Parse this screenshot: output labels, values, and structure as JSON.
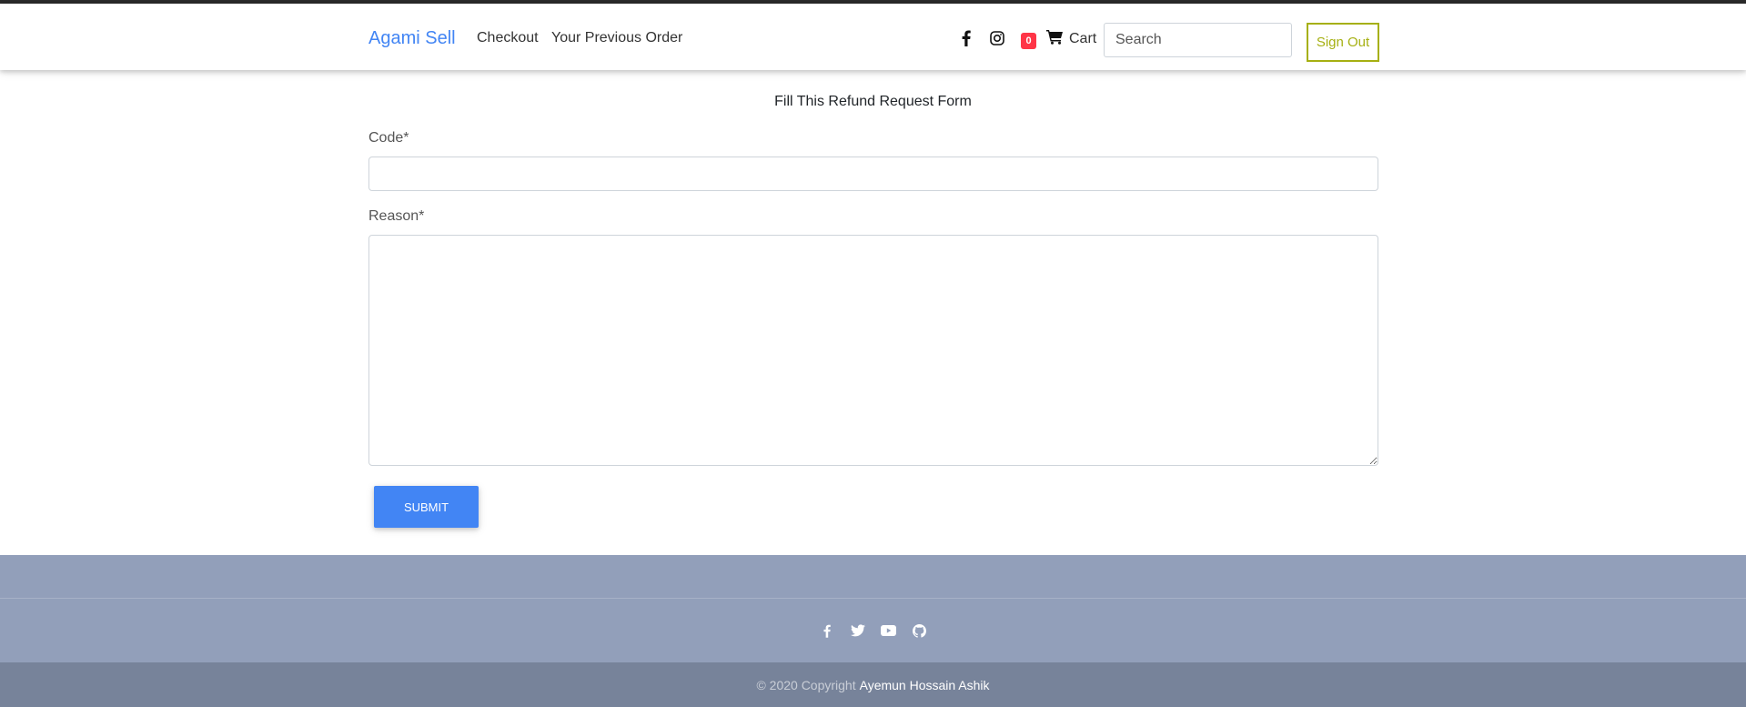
{
  "nav": {
    "brand": "Agami Sell",
    "links": [
      "Checkout",
      "Your Previous Order"
    ],
    "social_icons": [
      "facebook-icon",
      "instagram-icon"
    ],
    "cart_count": "0",
    "cart_label": "Cart",
    "search_placeholder": "Search",
    "signout_label": "Sign Out"
  },
  "form": {
    "title": "Fill This Refund Request Form",
    "code_label": "Code*",
    "code_value": "",
    "reason_label": "Reason*",
    "reason_value": "",
    "submit_label": "SUBMIT"
  },
  "footer": {
    "social_icons": [
      "facebook-icon",
      "twitter-icon",
      "youtube-icon",
      "github-icon"
    ],
    "copyright_prefix": "© 2020 Copyright",
    "author": "Ayemun Hossain Ashik"
  },
  "colors": {
    "brand": "#4285f4",
    "signout": "#a6b012",
    "badge": "#ff3547",
    "submit": "#4285f4",
    "footer": "#929fba",
    "copyright_bar": "#77839a"
  }
}
